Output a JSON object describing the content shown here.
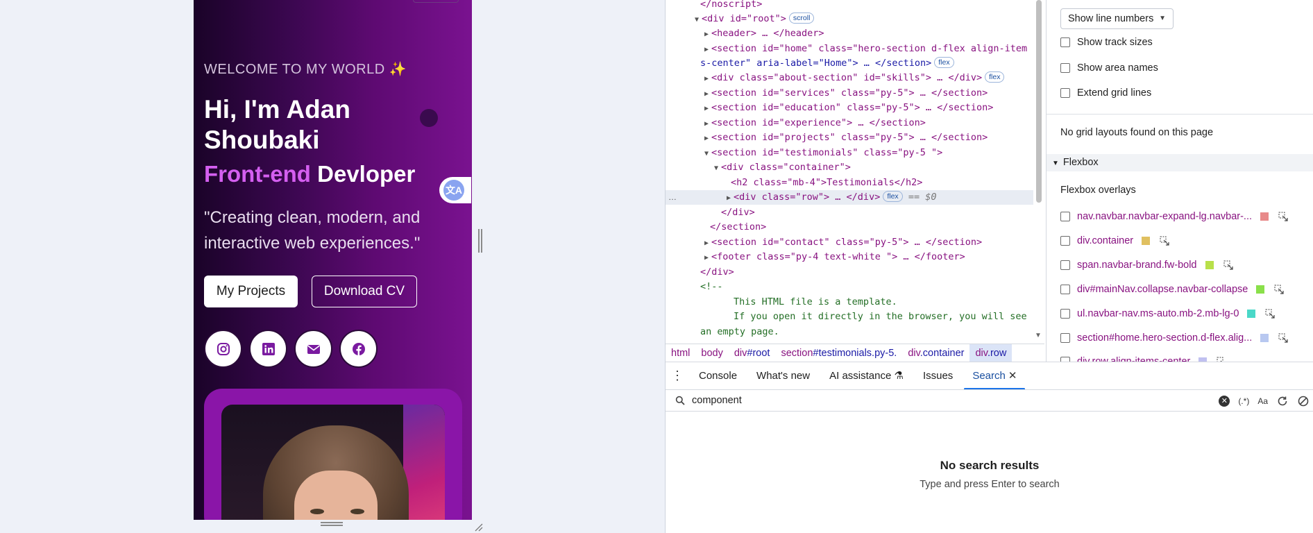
{
  "site": {
    "welcome": "WELCOME TO MY WORLD ✨",
    "name": "Hi, I'm Adan Shoubaki",
    "role_accent": "Front-end",
    "role_rest": " Devloper",
    "tagline": "\"Creating clean, modern, and interactive web experiences.\"",
    "btn_projects": "My Projects",
    "btn_cv": "Download CV",
    "translate_label": "文A",
    "socials": [
      "instagram-icon",
      "linkedin-icon",
      "envelope-icon",
      "facebook-icon"
    ]
  },
  "elements": {
    "lines": [
      {
        "t": "noscript_close",
        "text": "</noscript>"
      },
      {
        "t": "div_root",
        "text": "<div id=\"root\">",
        "badge": "scroll"
      },
      {
        "t": "header",
        "text": "<header> … </header>"
      },
      {
        "t": "section_home_1",
        "text": "<section id=\"home\" class=\"hero-section d-flex align-item"
      },
      {
        "t": "section_home_2",
        "text": "s-center\" aria-label=\"Home\"> … </section>",
        "badge": "flex"
      },
      {
        "t": "div_about",
        "text": "<div class=\"about-section\" id=\"skills\"> … </div>",
        "badge": "flex"
      },
      {
        "t": "section_services",
        "text": "<section id=\"services\" class=\"py-5\"> … </section>"
      },
      {
        "t": "section_education",
        "text": "<section id=\"education\" class=\"py-5\"> … </section>"
      },
      {
        "t": "section_experience",
        "text": "<section id=\"experience\"> … </section>"
      },
      {
        "t": "section_projects",
        "text": "<section id=\"projects\" class=\"py-5\"> … </section>"
      },
      {
        "t": "section_testimonials",
        "text": "<section id=\"testimonials\" class=\"py-5 \">"
      },
      {
        "t": "div_container",
        "text": "<div class=\"container\">"
      },
      {
        "t": "h2",
        "text": "<h2 class=\"mb-4\">Testimonials</h2>"
      },
      {
        "t": "div_row",
        "text": "<div class=\"row\"> … </div>",
        "badge": "flex",
        "suffix": "== $0"
      },
      {
        "t": "div_close",
        "text": "</div>"
      },
      {
        "t": "section_close",
        "text": "</section>"
      },
      {
        "t": "section_contact",
        "text": "<section id=\"contact\" class=\"py-5\"> … </section>"
      },
      {
        "t": "footer",
        "text": "<footer class=\"py-4  text-white \"> … </footer>"
      },
      {
        "t": "div_root_close",
        "text": "</div>"
      },
      {
        "t": "comment_open",
        "text": "<!--"
      },
      {
        "t": "comment_1",
        "text": "This HTML file is a template."
      },
      {
        "t": "comment_2",
        "text": "If you open it directly in the browser, you will see"
      },
      {
        "t": "comment_3",
        "text": "an empty page."
      }
    ],
    "dots": "…"
  },
  "breadcrumb": [
    {
      "tag": "html",
      "cls": ""
    },
    {
      "tag": "body",
      "cls": ""
    },
    {
      "tag": "div",
      "cls": "#root"
    },
    {
      "tag": "section",
      "cls": "#testimonials.py-5."
    },
    {
      "tag": "div",
      "cls": ".container"
    },
    {
      "tag": "div",
      "cls": ".row"
    }
  ],
  "sidebar": {
    "select_value": "Show line numbers",
    "checks": [
      "Show track sizes",
      "Show area names",
      "Extend grid lines"
    ],
    "no_grid": "No grid layouts found on this page",
    "flexbox_header": "Flexbox",
    "overlays_title": "Flexbox overlays",
    "flex_items": [
      {
        "label": "nav.navbar.navbar-expand-lg.navbar-...",
        "color": "#e88a8a"
      },
      {
        "label": "div.container",
        "color": "#e0c060"
      },
      {
        "label": "span.navbar-brand.fw-bold",
        "color": "#b8e04a"
      },
      {
        "label": "div#mainNav.collapse.navbar-collapse",
        "color": "#8ae04a"
      },
      {
        "label": "ul.navbar-nav.ms-auto.mb-2.mb-lg-0",
        "color": "#4ad8c8"
      },
      {
        "label": "section#home.hero-section.d-flex.alig...",
        "color": "#b8c8f0"
      },
      {
        "label": "div.row.align-items-center",
        "color": "#c0c0f0"
      }
    ]
  },
  "drawer": {
    "tabs": [
      "Console",
      "What's new",
      "AI assistance",
      "Issues",
      "Search"
    ],
    "active_tab": "Search",
    "search_value": "component",
    "regex_label": "(.*)",
    "case_label": "Aa",
    "no_results_title": "No search results",
    "no_results_sub": "Type and press Enter to search"
  }
}
